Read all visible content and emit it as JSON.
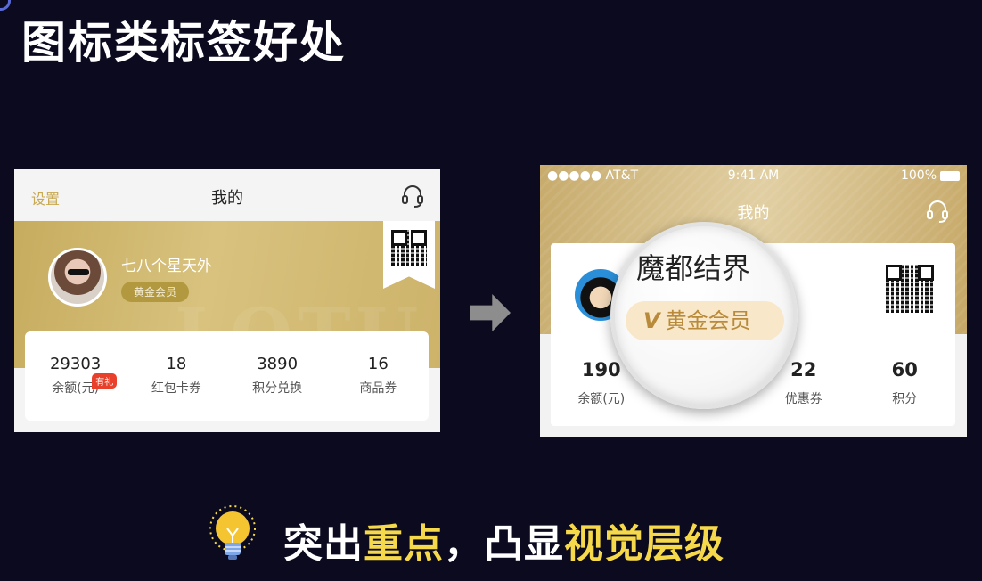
{
  "slide": {
    "title": "图标类标签好处",
    "caption_parts": [
      {
        "text": "突出",
        "color": "#ffffff"
      },
      {
        "text": "重点",
        "color": "#f5d94a"
      },
      {
        "text": "，凸显",
        "color": "#ffffff"
      },
      {
        "text": "视觉层级",
        "color": "#f5d94a"
      }
    ]
  },
  "left_mockup": {
    "nav": {
      "settings": "设置",
      "title": "我的",
      "icon": "headset-icon"
    },
    "profile": {
      "name": "七八个星天外",
      "badge": "黄金会员",
      "watermark": "LOTU"
    },
    "stats": [
      {
        "value": "29303",
        "label": "余额(元)",
        "tag": "有礼"
      },
      {
        "value": "18",
        "label": "红包卡券"
      },
      {
        "value": "3890",
        "label": "积分兑换"
      },
      {
        "value": "16",
        "label": "商品券"
      }
    ],
    "colors": {
      "hero": "#d8c27e",
      "badge": "#b2983e",
      "tag": "#e8402a"
    }
  },
  "right_mockup": {
    "status_bar": {
      "carrier": "●●●●● AT&T",
      "time": "9:41 AM",
      "battery": "100%"
    },
    "nav": {
      "title": "我的",
      "icon": "headset-icon"
    },
    "stats": [
      {
        "value": "190",
        "label": "余额(元)"
      },
      {
        "value": "",
        "label": ""
      },
      {
        "value": "22",
        "label": "优惠券"
      },
      {
        "value": "60",
        "label": "积分"
      }
    ],
    "magnifier": {
      "name": "魔都结界",
      "badge_mark": "V",
      "badge": "黄金会员"
    },
    "colors": {
      "hero": "#e1cfa3",
      "badge_bg": "#f8e7c8",
      "badge_text": "#b88a3a"
    }
  }
}
